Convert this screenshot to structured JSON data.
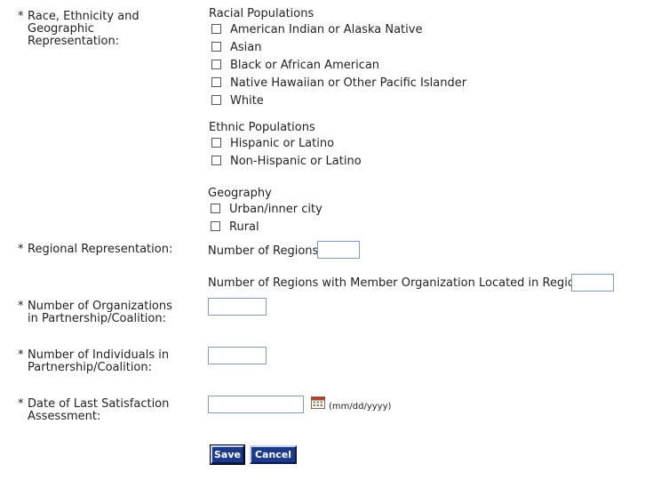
{
  "race_section": {
    "required_mark": "*",
    "label_lines": [
      "Race, Ethnicity and",
      "Geographic",
      "Representation:"
    ],
    "racial_title": "Racial Populations",
    "racial_options": [
      "American Indian or Alaska Native",
      "Asian",
      "Black or African American",
      "Native Hawaiian or Other Pacific Islander",
      "White"
    ],
    "ethnic_title": "Ethnic Populations",
    "ethnic_options": [
      "Hispanic or Latino",
      "Non-Hispanic or Latino"
    ],
    "geo_title": "Geography",
    "geo_options": [
      "Urban/inner city",
      "Rural"
    ]
  },
  "regional": {
    "required_mark": "*",
    "label": "Regional Representation:",
    "num_regions_label": "Number of Regions",
    "num_regions_value": "",
    "member_regions_label": "Number of Regions with Member Organization Located in Region",
    "member_regions_value": ""
  },
  "organizations": {
    "required_mark": "*",
    "label_lines": [
      "Number of Organizations",
      "in Partnership/Coalition:"
    ],
    "value": ""
  },
  "individuals": {
    "required_mark": "*",
    "label_lines": [
      "Number of Individuals in",
      "Partnership/Coalition:"
    ],
    "value": ""
  },
  "satisfaction": {
    "required_mark": "*",
    "label_lines": [
      "Date of Last Satisfaction",
      "Assessment:"
    ],
    "value": "",
    "date_hint": "(mm/dd/yyyy)",
    "calendar_icon": "calendar-icon"
  },
  "buttons": {
    "save": "Save",
    "cancel": "Cancel"
  },
  "colors": {
    "button_bg": "#1b3a8a",
    "input_border": "#7f9db9"
  }
}
